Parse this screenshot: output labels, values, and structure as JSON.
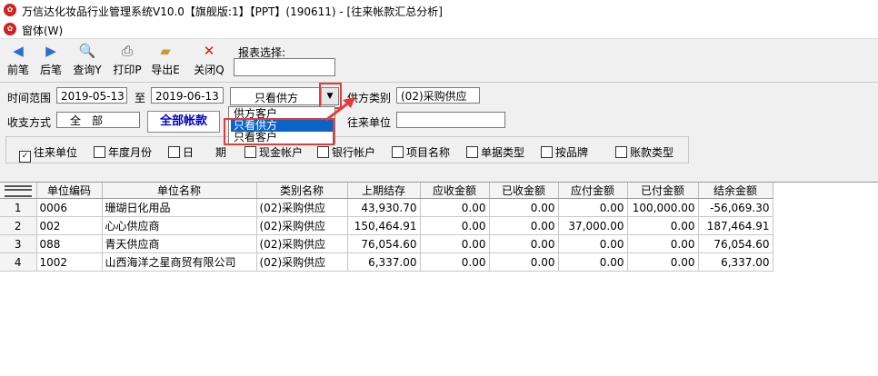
{
  "window": {
    "title": "万信达化妆品行业管理系统V10.0【旗舰版:1】【PPT】(190611) - [往来帐款汇总分析]",
    "app_icon": "app-logo-icon"
  },
  "menu": {
    "items": [
      "窗体(W)"
    ]
  },
  "toolbar": {
    "buttons": [
      {
        "label": "前笔",
        "icon": "arrow-left-icon"
      },
      {
        "label": "后笔",
        "icon": "arrow-right-icon"
      },
      {
        "label": "查询Y",
        "icon": "search-doc-icon"
      },
      {
        "label": "打印P",
        "icon": "printer-icon"
      },
      {
        "label": "导出E",
        "icon": "export-folder-icon"
      },
      {
        "label": "关闭Q",
        "icon": "close-x-icon"
      }
    ],
    "report_select_label": "报表选择:",
    "report_select_value": ""
  },
  "filters": {
    "time_range_label": "时间范围",
    "date_from": "2019-05-13",
    "to_label": "至",
    "date_to": "2019-06-13",
    "supplier_combo_value": "只看供方",
    "supplier_category_label": "供方类别",
    "supplier_category_value": "(02)采购供应",
    "payment_method_label": "收支方式",
    "payment_method_value": "全　部",
    "all_accounts_button": "全部帐款",
    "partner_label": "往来单位",
    "partner_value": "",
    "dropdown_options": [
      "供方客户",
      "只看供方",
      "只看客户"
    ],
    "dropdown_selected_index": 1
  },
  "checkboxes": [
    {
      "label": "往来单位",
      "checked": true
    },
    {
      "label": "年度月份",
      "checked": false
    },
    {
      "label": "日",
      "checked": false
    },
    {
      "label": "期",
      "checked": false
    },
    {
      "label": "现金帐户",
      "checked": false
    },
    {
      "label": "银行帐户",
      "checked": false
    },
    {
      "label": "项目名称",
      "checked": false
    },
    {
      "label": "单据类型",
      "checked": false
    },
    {
      "label": "按品牌",
      "checked": false
    },
    {
      "label": "账款类型",
      "checked": false
    }
  ],
  "table": {
    "columns": [
      "单位编码",
      "单位名称",
      "类别名称",
      "上期结存",
      "应收金额",
      "已收金额",
      "应付金额",
      "已付金额",
      "结余金额"
    ],
    "rows": [
      {
        "idx": "1",
        "cells": [
          "0006",
          "珊瑚日化用品",
          "(02)采购供应",
          "43,930.70",
          "0.00",
          "0.00",
          "0.00",
          "100,000.00",
          "-56,069.30"
        ]
      },
      {
        "idx": "2",
        "cells": [
          "002",
          "心心供应商",
          "(02)采购供应",
          "150,464.91",
          "0.00",
          "0.00",
          "37,000.00",
          "0.00",
          "187,464.91"
        ]
      },
      {
        "idx": "3",
        "cells": [
          "088",
          "青天供应商",
          "(02)采购供应",
          "76,054.60",
          "0.00",
          "0.00",
          "0.00",
          "0.00",
          "76,054.60"
        ]
      },
      {
        "idx": "4",
        "cells": [
          "1002",
          "山西海洋之星商贸有限公司",
          "(02)采购供应",
          "6,337.00",
          "0.00",
          "0.00",
          "0.00",
          "0.00",
          "6,337.00"
        ]
      }
    ]
  },
  "colors": {
    "highlight_red": "#e23b3b",
    "selection_blue": "#0a64c8",
    "link_blue": "#0000cc"
  }
}
